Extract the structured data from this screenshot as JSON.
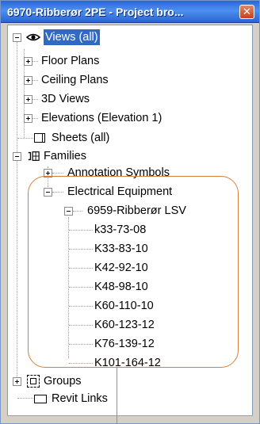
{
  "window": {
    "title": "6970-Ribberør 2PE - Project bro...",
    "close_glyph": "✕"
  },
  "tree": {
    "views": {
      "label": "Views (all)",
      "icon": "eye-icon",
      "children": [
        "Floor Plans",
        "Ceiling Plans",
        "3D Views",
        "Elevations (Elevation 1)"
      ]
    },
    "sheets": {
      "label": "Sheets (all)",
      "icon": "sheet-icon"
    },
    "families": {
      "label": "Families",
      "icon": "families-icon",
      "children": {
        "annotation_symbols": "Annotation Symbols",
        "electrical_equipment": "Electrical Equipment",
        "family": "6959-Ribberør LSV",
        "types": [
          "k33-73-08",
          "K33-83-10",
          "K42-92-10",
          "K48-98-10",
          "K60-110-10",
          "K60-123-12",
          "K76-139-12",
          "K101-164-12"
        ]
      }
    },
    "groups": {
      "label": "Groups",
      "icon": "groups-icon"
    },
    "revit_links": {
      "label": "Revit Links",
      "icon": "links-icon"
    }
  },
  "colors": {
    "titlebar": "#2a66d6",
    "selection": "#316ac5",
    "annotation": "#d0823a"
  }
}
